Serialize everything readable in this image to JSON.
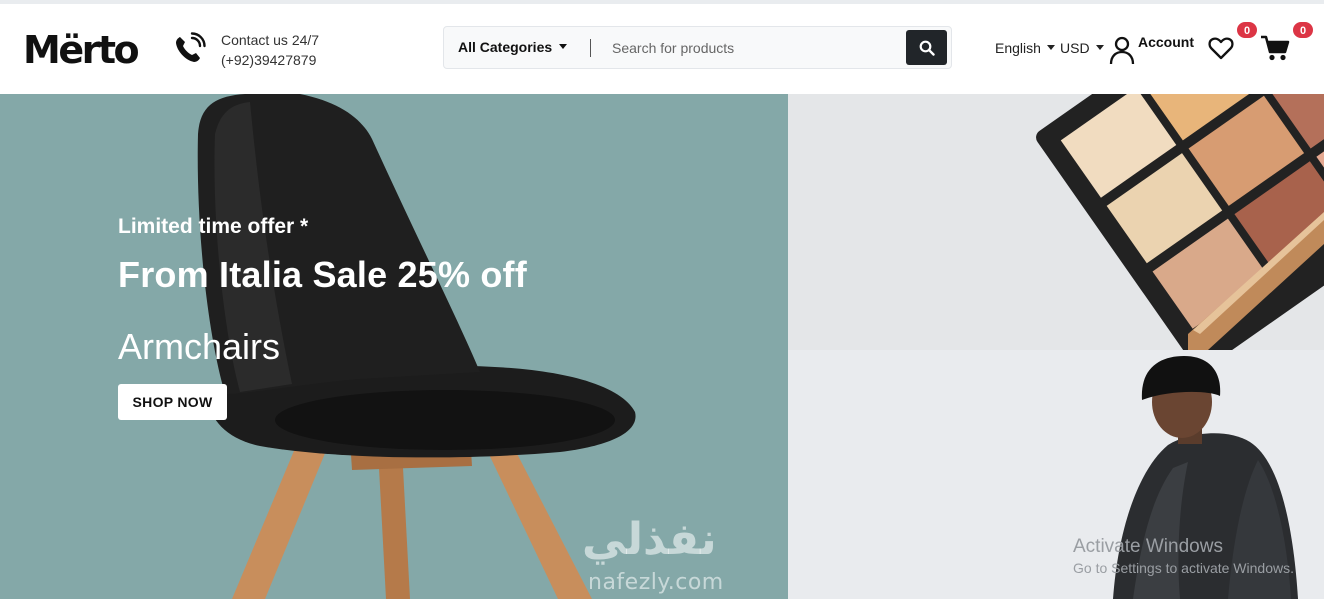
{
  "header": {
    "logo_text": "Mërto",
    "contact": {
      "line1": "Contact us 24/7",
      "line2": "(+92)39427879",
      "icon": "phone-icon"
    },
    "search": {
      "category_label": "All Categories",
      "placeholder": "Search for products",
      "value": "",
      "button_icon": "search-icon"
    },
    "language": "English",
    "currency": "USD",
    "account_label": "Account",
    "wishlist_count": "0",
    "cart_count": "0"
  },
  "hero": {
    "eyebrow": "Limited time offer *",
    "headline": "From Italia Sale 25% off",
    "sub": "Armchairs",
    "cta_label": "SHOP NOW",
    "background_color": "#84a8a8"
  },
  "watermark": {
    "arabic": "نفذلي",
    "latin": "nafezly.com"
  },
  "os_overlay": {
    "title": "Activate Windows",
    "subtitle": "Go to Settings to activate Windows."
  },
  "colors": {
    "badge": "#dc3545",
    "search_button": "#212529",
    "logo_accent": "#c62828"
  }
}
